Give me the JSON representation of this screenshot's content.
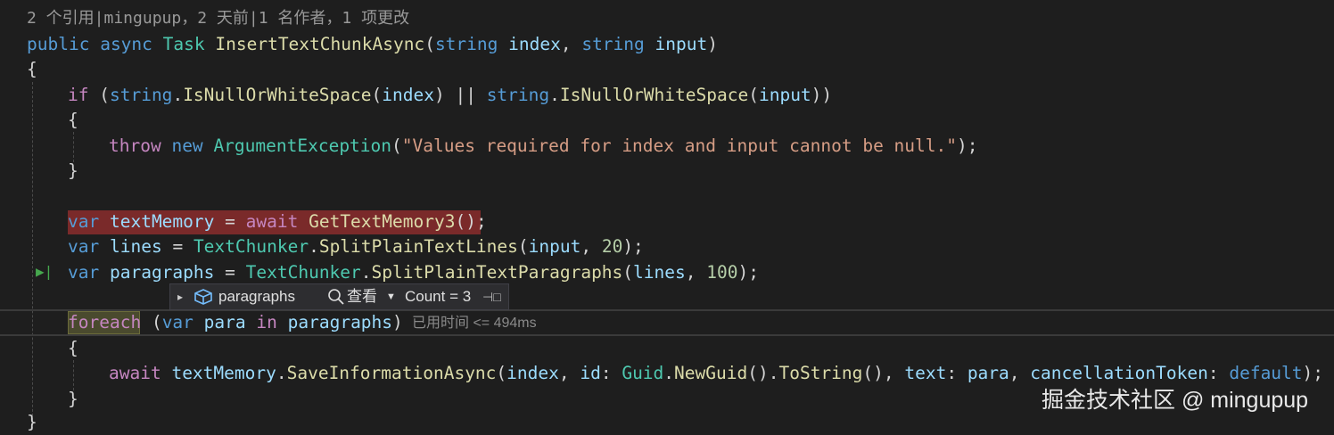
{
  "codelens": "2 个引用|mingupup，2 天前|1 名作者，1 项更改",
  "signature": {
    "public": "public",
    "async": "async",
    "task": "Task",
    "method": "InsertTextChunkAsync",
    "string1": "string",
    "p1": "index",
    "string2": "string",
    "p2": "input"
  },
  "if_line": {
    "if": "if",
    "string1": "string",
    "fn1": "IsNullOrWhiteSpace",
    "arg1": "index",
    "or": "||",
    "string2": "string",
    "fn2": "IsNullOrWhiteSpace",
    "arg2": "input"
  },
  "throw_line": {
    "throw": "throw",
    "new": "new",
    "type": "ArgumentException",
    "message": "\"Values required for index and input cannot be null.\""
  },
  "memory_line": {
    "var": "var",
    "name": "textMemory",
    "await": "await",
    "fn": "GetTextMemory3"
  },
  "lines_line": {
    "var": "var",
    "name": "lines",
    "cls": "TextChunker",
    "fn": "SplitPlainTextLines",
    "arg": "input",
    "num": "20"
  },
  "paragraphs_line": {
    "var": "var",
    "name": "paragraphs",
    "cls": "TextChunker",
    "fn": "SplitPlainTextParagraphs",
    "arg": "lines",
    "num": "100"
  },
  "datatip": {
    "expand": "▸",
    "name": "paragraphs",
    "view_label": "查看",
    "count": "Count = 3",
    "pin": "⊣□"
  },
  "foreach_line": {
    "foreach": "foreach",
    "var": "var",
    "item": "para",
    "in": "in",
    "collection": "paragraphs"
  },
  "elapsed": "已用时间 <= 494ms",
  "save_line": {
    "await": "await",
    "obj": "textMemory",
    "fn": "SaveInformationAsync",
    "arg1": "index",
    "id_label": "id",
    "guid": "Guid",
    "newguid": "NewGuid",
    "tostring": "ToString",
    "text_label": "text",
    "para": "para",
    "ct_label": "cancellationToken",
    "default": "default"
  },
  "watermark": "掘金技术社区 @ mingupup",
  "colors": {
    "background": "#1e1e1e",
    "breakpoint_highlight": "#7a2a2a",
    "keyword": "#569cd6",
    "type": "#4ec9b0",
    "method": "#dcdcaa",
    "string": "#d69d85"
  }
}
